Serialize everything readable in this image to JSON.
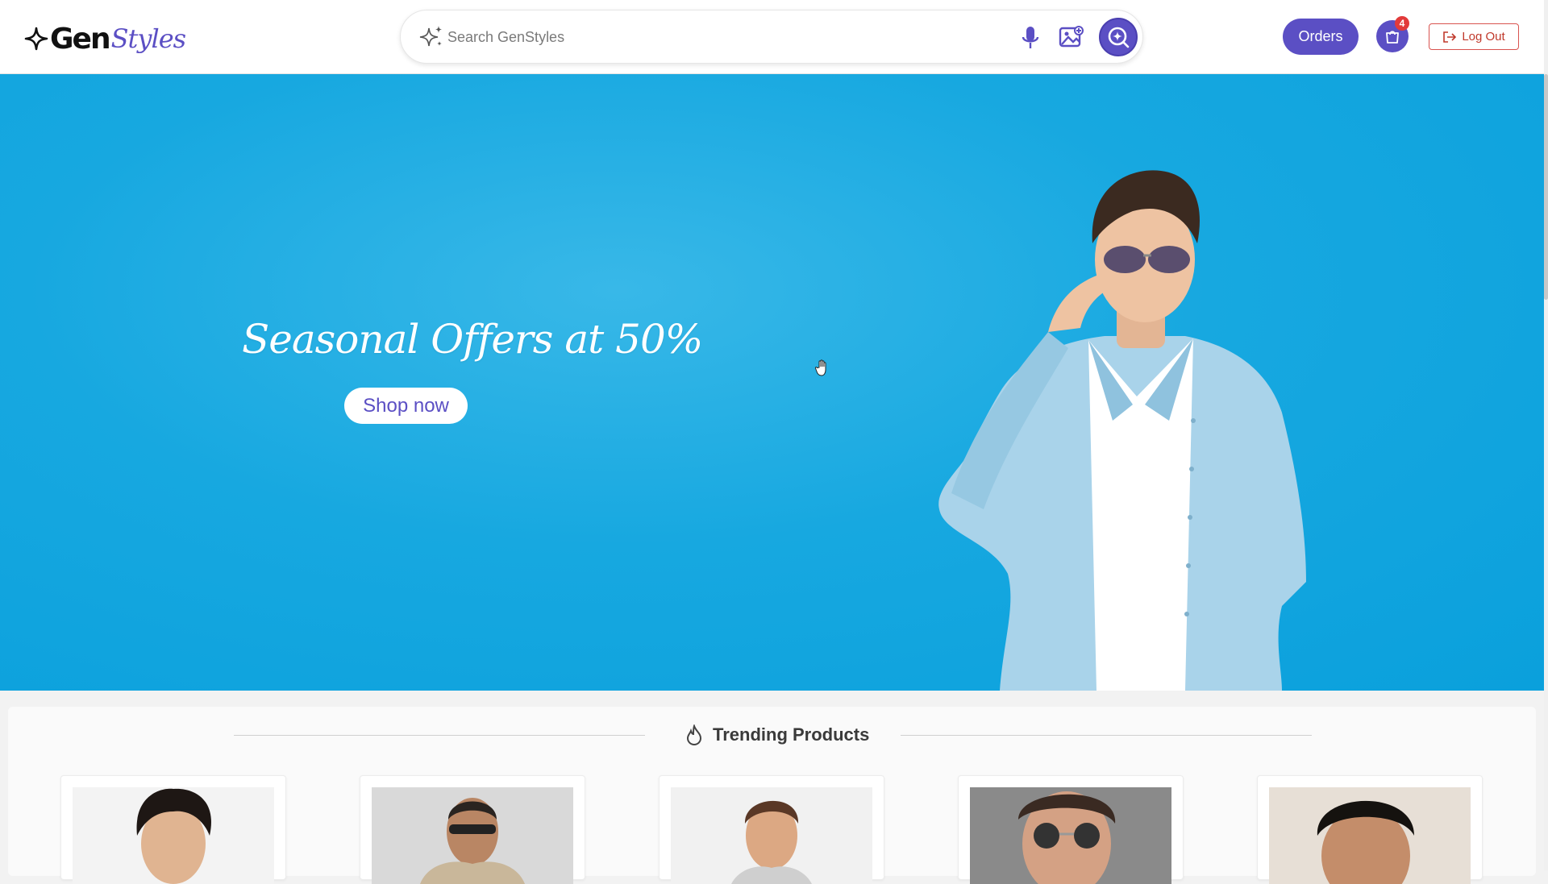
{
  "header": {
    "logo_gen": "Gen",
    "logo_styles": "Styles",
    "search_placeholder": "Search GenStyles",
    "orders_label": "Orders",
    "cart_count": "4",
    "logout_label": "Log Out"
  },
  "hero": {
    "title": "Seasonal Offers at 50%",
    "cta_label": "Shop now"
  },
  "trending": {
    "title": "Trending Products",
    "products": [
      {
        "name": "product-1",
        "bg": "#f3f3f3"
      },
      {
        "name": "product-2",
        "bg": "#d9d9d9"
      },
      {
        "name": "product-3",
        "bg": "#f1f1f1"
      },
      {
        "name": "product-4",
        "bg": "#8a8a8a"
      },
      {
        "name": "product-5",
        "bg": "#e7dfd6"
      }
    ]
  },
  "colors": {
    "brand": "#5b4fc4",
    "hero_bg": "#17a8e0",
    "badge": "#e23a3a",
    "logout": "#c0392b"
  },
  "icons": [
    "sparkle-icon",
    "mic-icon",
    "image-search-icon",
    "ai-search-icon",
    "cart-icon",
    "logout-icon",
    "flame-icon",
    "hand-cursor-icon"
  ]
}
